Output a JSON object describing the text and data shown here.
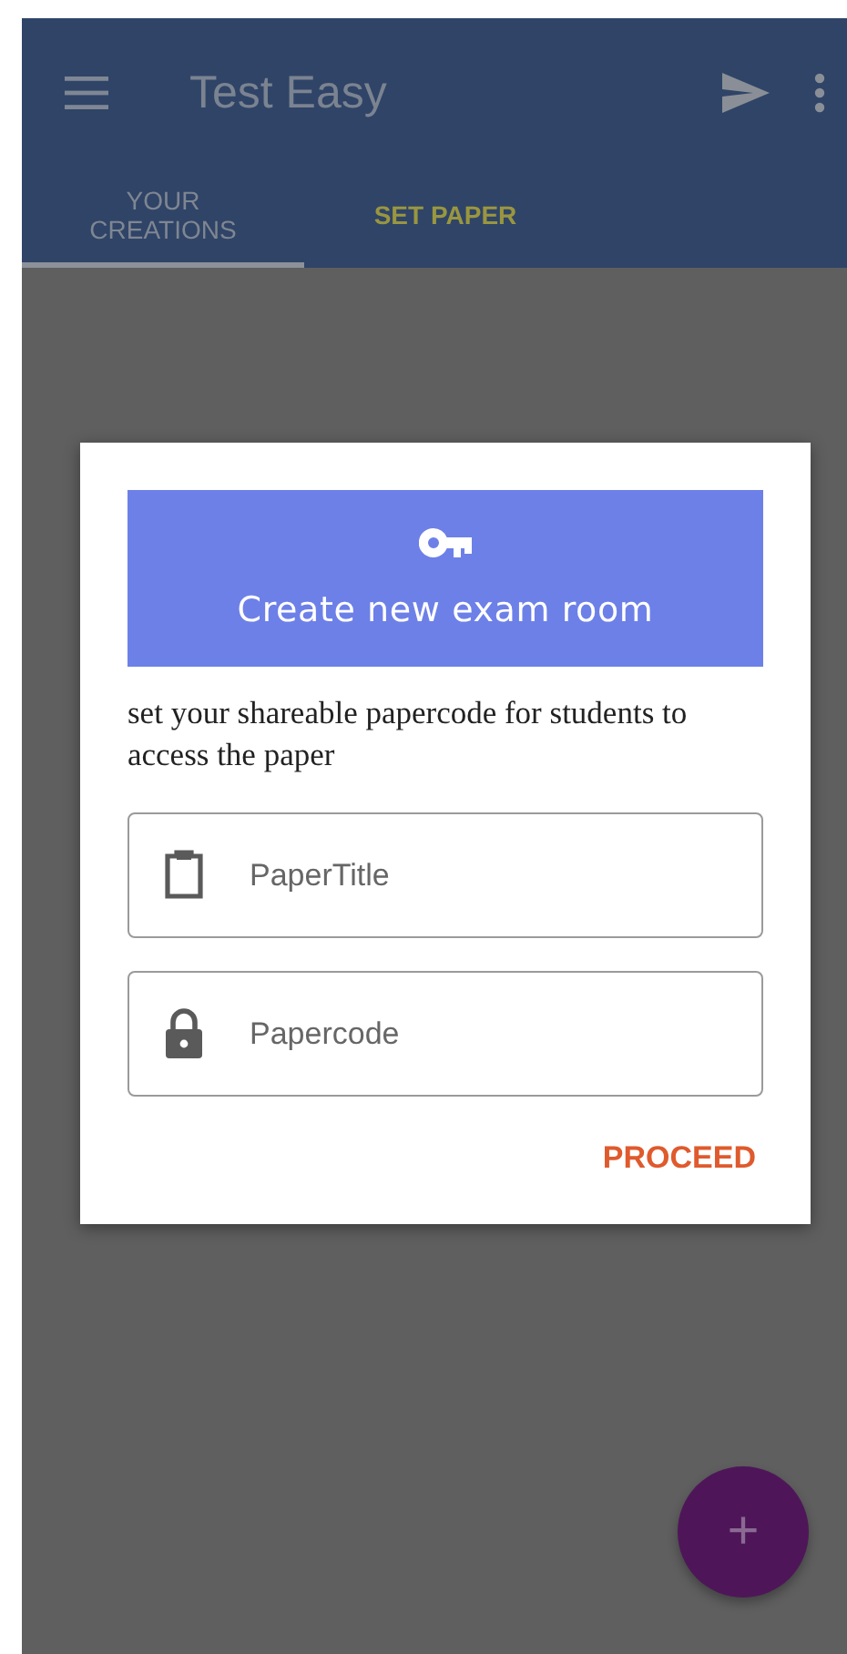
{
  "app_bar": {
    "title": "Test Easy"
  },
  "tabs": [
    {
      "label": "YOUR CREATIONS",
      "selected": true
    },
    {
      "label": "SET PAPER",
      "selected": false
    }
  ],
  "dialog": {
    "banner_title": "Create new exam room",
    "description": "set your shareable papercode for students to access the paper",
    "fields": [
      {
        "kind": "clipboard",
        "placeholder": "PaperTitle"
      },
      {
        "kind": "lock",
        "placeholder": "Papercode"
      }
    ],
    "action": "PROCEED"
  },
  "fab": {
    "label": "+"
  }
}
